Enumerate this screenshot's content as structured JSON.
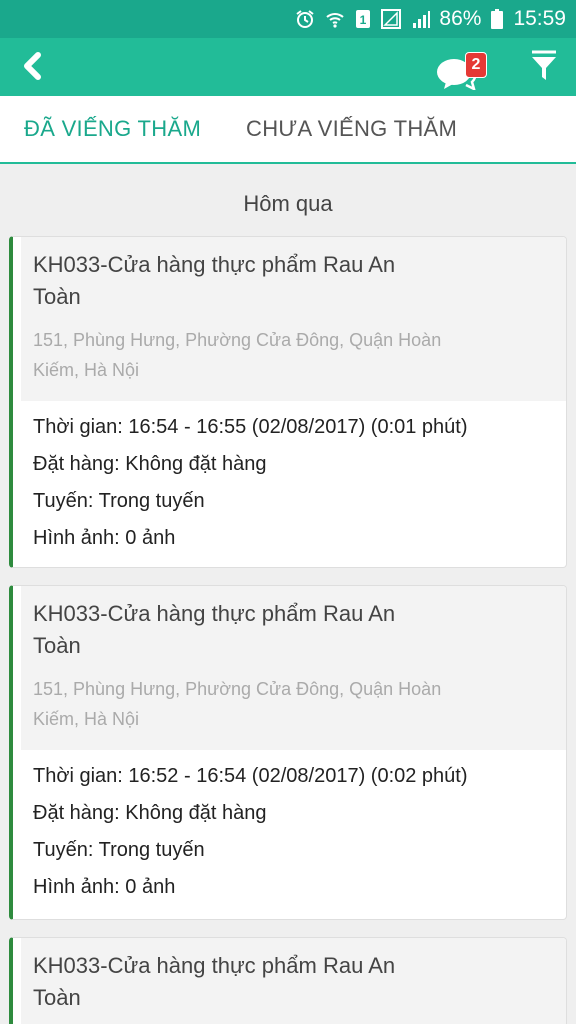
{
  "status_bar": {
    "battery": "86%",
    "time": "15:59",
    "icons": [
      "alarm-icon",
      "wifi-icon",
      "sim-icon",
      "signal-empty-icon",
      "signal-icon",
      "battery-icon"
    ]
  },
  "app_bar": {
    "back_icon": "chevron-left-icon",
    "chat_icon": "chat-bubbles-icon",
    "chat_badge": "2",
    "filter_icon": "filter-icon",
    "colors": {
      "primary": "#22bc98",
      "status": "#1aa88c",
      "badge": "#e53935",
      "card_accent": "#2e8b3e"
    }
  },
  "tabs": [
    {
      "label": "ĐÃ VIẾNG THĂM",
      "active": true
    },
    {
      "label": "CHƯA VIẾNG THĂM",
      "active": false
    }
  ],
  "section": {
    "title": "Hôm qua"
  },
  "visits": [
    {
      "store": "KH033-Cửa hàng thực phẩm Rau An Toàn",
      "address": "151, Phùng Hưng, Phường Cửa Đông, Quận Hoàn Kiếm, Hà Nội",
      "time_line": "Thời gian: 16:54 - 16:55 (02/08/2017) (0:01 phút)",
      "order_line": "Đặt hàng: Không đặt hàng",
      "route_line": "Tuyến: Trong tuyến",
      "image_line": "Hình ảnh: 0 ảnh"
    },
    {
      "store": "KH033-Cửa hàng thực phẩm Rau An Toàn",
      "address": "151, Phùng Hưng, Phường Cửa Đông, Quận Hoàn Kiếm, Hà Nội",
      "time_line": "Thời gian: 16:52 - 16:54 (02/08/2017) (0:02 phút)",
      "order_line": "Đặt hàng: Không đặt hàng",
      "route_line": "Tuyến: Trong tuyến",
      "image_line": "Hình ảnh: 0 ảnh"
    },
    {
      "store": "KH033-Cửa hàng thực phẩm Rau An Toàn"
    }
  ]
}
